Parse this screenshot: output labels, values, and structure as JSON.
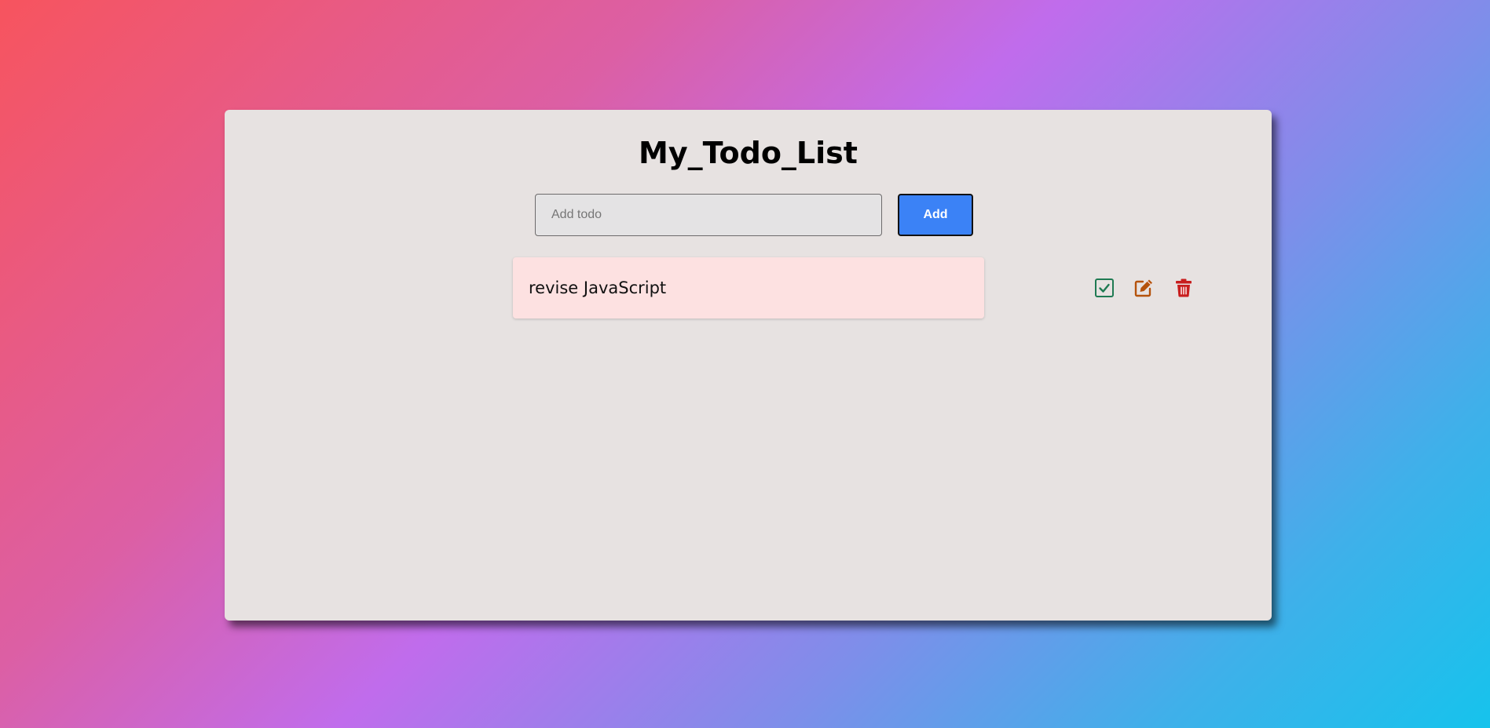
{
  "app": {
    "title": "My_Todo_List"
  },
  "form": {
    "input_placeholder": "Add todo",
    "input_value": "",
    "add_label": "Add"
  },
  "todos": [
    {
      "text": "revise JavaScript",
      "actions": [
        "check-square-icon",
        "edit-icon",
        "trash-icon"
      ]
    }
  ],
  "colors": {
    "add_button": "#3b82f6",
    "todo_bg": "#fde1e1",
    "check": "#1f7a52",
    "edit": "#b5520b",
    "delete": "#c81e1e"
  }
}
